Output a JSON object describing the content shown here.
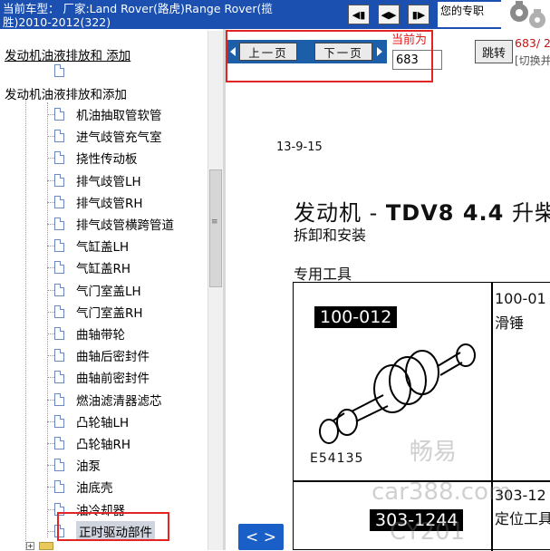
{
  "header": {
    "car_info": "当前车型： 厂家:Land Rover(路虎)Range Rover(揽胜)2010-2012(322)",
    "nav_buttons": [
      "first-page",
      "previous",
      "next"
    ],
    "expert_text": "您的专职",
    "gears_image": "gears-icon"
  },
  "tree": {
    "root_link": "发动机油液排放和 添加",
    "section_label": "发动机油液排放和添加",
    "items": [
      {
        "label": "机油抽取管软管",
        "icon": "document-icon"
      },
      {
        "label": "进气歧管充气室",
        "icon": "document-icon"
      },
      {
        "label": "挠性传动板",
        "icon": "document-icon"
      },
      {
        "label": "排气歧管LH",
        "icon": "document-icon"
      },
      {
        "label": "排气歧管RH",
        "icon": "document-icon"
      },
      {
        "label": "排气歧管横跨管道",
        "icon": "document-icon"
      },
      {
        "label": "气缸盖LH",
        "icon": "document-icon"
      },
      {
        "label": "气缸盖RH",
        "icon": "document-icon"
      },
      {
        "label": "气门室盖LH",
        "icon": "document-icon"
      },
      {
        "label": "气门室盖RH",
        "icon": "document-icon"
      },
      {
        "label": "曲轴带轮",
        "icon": "document-icon"
      },
      {
        "label": "曲轴后密封件",
        "icon": "document-icon"
      },
      {
        "label": "曲轴前密封件",
        "icon": "document-icon"
      },
      {
        "label": "燃油滤清器滤芯",
        "icon": "document-icon"
      },
      {
        "label": "凸轮轴LH",
        "icon": "document-icon"
      },
      {
        "label": "凸轮轴RH",
        "icon": "document-icon"
      },
      {
        "label": "油泵",
        "icon": "document-icon"
      },
      {
        "label": "油底壳",
        "icon": "document-icon"
      },
      {
        "label": "油冷却器",
        "icon": "document-icon"
      },
      {
        "label": "正时驱动部件",
        "icon": "document-icon",
        "selected": true
      }
    ]
  },
  "pager": {
    "prev_label": "上一页",
    "next_label": "下一页",
    "current_label": "当前为",
    "current_value": "683",
    "jump_label": "跳转",
    "total_text": "683/ 2",
    "switch_hint": "[切换并"
  },
  "document": {
    "date": "13-9-15",
    "title_cn": "发动机 - ",
    "title_bold": "TDV8 4.4",
    "title_suffix": " 升柴",
    "subtitle": "拆卸和安装",
    "tools_heading": "专用工具",
    "tools": [
      {
        "code_badge": "100-012",
        "number": "100-01",
        "name": "滑锤",
        "figure": "E54135"
      },
      {
        "code_badge": "303-1244",
        "number": "303-12",
        "name": "定位工具"
      }
    ]
  },
  "footer": {
    "back_label": "< >"
  },
  "watermarks": [
    "畅易",
    "car388.com",
    "CY201"
  ]
}
